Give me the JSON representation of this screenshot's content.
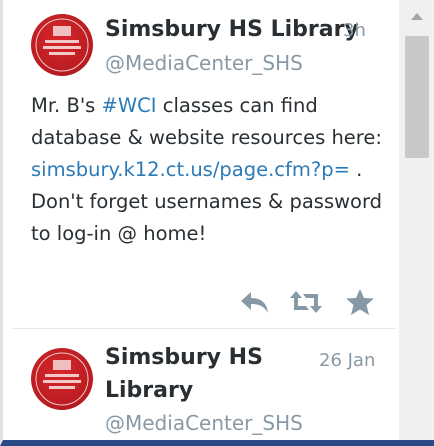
{
  "tweets": [
    {
      "author_name": "Simsbury HS Library",
      "author_handle": "@MediaCenter_SHS",
      "time": "3h",
      "text_before_tag": "Mr. B's ",
      "hashtag": "#WCI",
      "text_after_tag": " classes can find database & website resources here: ",
      "link": "simsbury.k12.ct.us/page.cfm?p=",
      "text_after_link": " . Don't forget usernames & password to log-in @ home!",
      "actions": [
        "reply-icon",
        "retweet-icon",
        "favorite-icon"
      ]
    },
    {
      "author_name_line1": "Simsbury HS",
      "author_name_line2": "Library",
      "author_handle": "@MediaCenter_SHS",
      "time": "26 Jan"
    }
  ],
  "colors": {
    "link": "#2b7bb9",
    "meta": "#8899a6",
    "avatar": "#c4161c",
    "action_icon": "#8899a6",
    "bottom_border": "#2b4a8a"
  }
}
